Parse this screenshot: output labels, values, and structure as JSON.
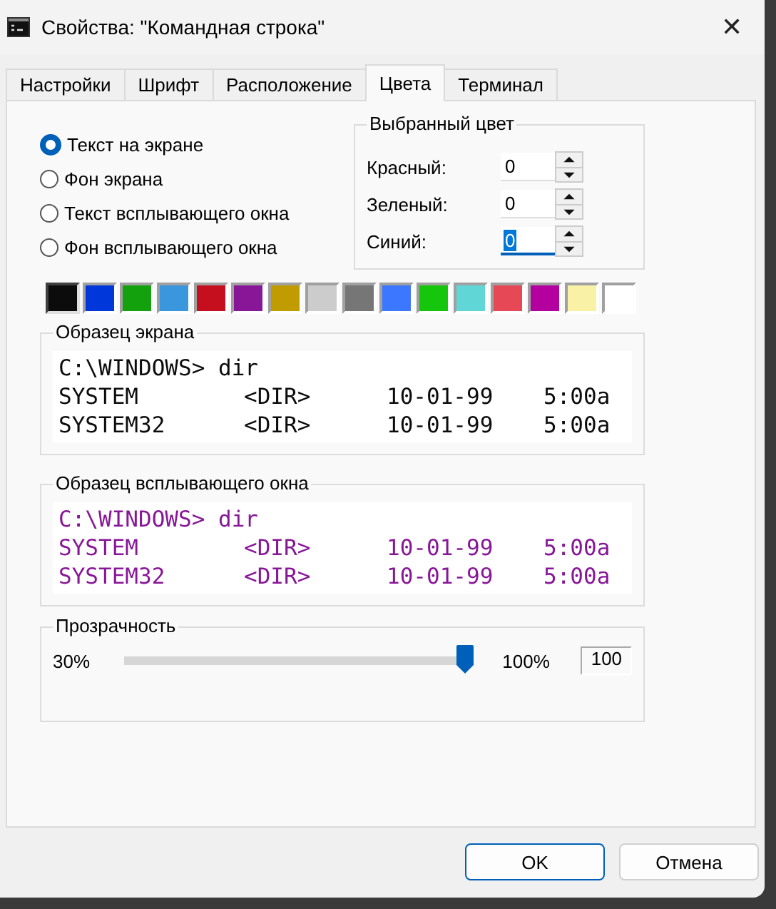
{
  "window": {
    "title": "Свойства: \"Командная строка\"",
    "close": "✕"
  },
  "tabs": [
    {
      "label": "Настройки",
      "selected": false
    },
    {
      "label": "Шрифт",
      "selected": false
    },
    {
      "label": "Расположение",
      "selected": false
    },
    {
      "label": "Цвета",
      "selected": true
    },
    {
      "label": "Терминал",
      "selected": false
    }
  ],
  "targets": [
    {
      "label": "Текст на экране",
      "selected": true
    },
    {
      "label": "Фон экрана",
      "selected": false
    },
    {
      "label": "Текст всплывающего окна",
      "selected": false
    },
    {
      "label": "Фон всплывающего окна",
      "selected": false
    }
  ],
  "selected_color": {
    "title": "Выбранный цвет",
    "fields": [
      {
        "label": "Красный:",
        "value": "0",
        "focused": false
      },
      {
        "label": "Зеленый:",
        "value": "0",
        "focused": false
      },
      {
        "label": "Синий:",
        "value": "0",
        "focused": true
      }
    ]
  },
  "palette": [
    {
      "color": "#0c0c0c",
      "selected": true
    },
    {
      "color": "#0037da",
      "selected": false
    },
    {
      "color": "#13a10e",
      "selected": false
    },
    {
      "color": "#3a96dd",
      "selected": false
    },
    {
      "color": "#c50f1f",
      "selected": false
    },
    {
      "color": "#881798",
      "selected": false
    },
    {
      "color": "#c19c00",
      "selected": false
    },
    {
      "color": "#cccccc",
      "selected": false
    },
    {
      "color": "#767676",
      "selected": false
    },
    {
      "color": "#3b78ff",
      "selected": false
    },
    {
      "color": "#16c60c",
      "selected": false
    },
    {
      "color": "#61d6d6",
      "selected": false
    },
    {
      "color": "#e74856",
      "selected": false
    },
    {
      "color": "#b4009e",
      "selected": false
    },
    {
      "color": "#f9f1a5",
      "selected": false
    },
    {
      "color": "#ffffff",
      "selected": false
    }
  ],
  "samples": [
    {
      "title": "Образец экрана",
      "color": "#0c0c0c",
      "prompt": "C:\\WINDOWS> dir",
      "rows": [
        [
          "SYSTEM",
          "<DIR>",
          "10-01-99",
          "5:00a"
        ],
        [
          "SYSTEM32",
          "<DIR>",
          "10-01-99",
          "5:00a"
        ]
      ]
    },
    {
      "title": "Образец всплывающего окна",
      "color": "#881798",
      "prompt": "C:\\WINDOWS> dir",
      "rows": [
        [
          "SYSTEM",
          "<DIR>",
          "10-01-99",
          "5:00a"
        ],
        [
          "SYSTEM32",
          "<DIR>",
          "10-01-99",
          "5:00a"
        ]
      ]
    }
  ],
  "opacity": {
    "title": "Прозрачность",
    "min_label": "30%",
    "max_label": "100%",
    "level": 1,
    "value": "100"
  },
  "buttons": [
    {
      "label": "OK",
      "default": true
    },
    {
      "label": "Отмена",
      "default": false
    }
  ]
}
